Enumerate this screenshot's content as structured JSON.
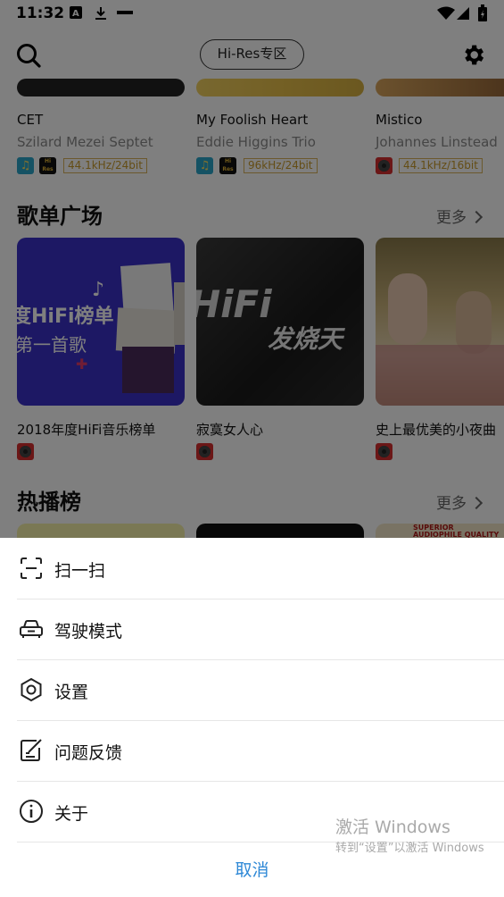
{
  "status_bar": {
    "time": "11:32"
  },
  "top_bar": {
    "hires_button": "Hi-Res专区"
  },
  "albums": [
    {
      "title": "CET",
      "artist": "Szilard Mezei Septet",
      "quality": "44.1kHz/24bit"
    },
    {
      "title": "My Foolish Heart",
      "artist": "Eddie Higgins Trio",
      "quality": "96kHz/24bit"
    },
    {
      "title": "Mistico",
      "artist": "Johannes Linstead",
      "quality": "44.1kHz/16bit"
    }
  ],
  "playlist_section": {
    "title": "歌单广场",
    "more": "更多",
    "items": [
      {
        "title": "2018年度HiFi音乐榜单",
        "cover_text_1": "度HiFi榜单",
        "cover_text_2": "第一首歌"
      },
      {
        "title": "寂寞女人心",
        "cover_text_1": "HiFi",
        "cover_text_2": "发烧天"
      },
      {
        "title": "史上最优美的小夜曲"
      }
    ]
  },
  "chart_section": {
    "title": "热播榜",
    "more": "更多",
    "thumb_text": "SUPERIOR AUDIOPHILE QUALITY"
  },
  "menu": {
    "items": [
      {
        "label": "扫一扫",
        "icon": "scan-icon"
      },
      {
        "label": "驾驶模式",
        "icon": "car-icon"
      },
      {
        "label": "设置",
        "icon": "hexagon-settings-icon"
      },
      {
        "label": "问题反馈",
        "icon": "feedback-icon"
      },
      {
        "label": "关于",
        "icon": "info-icon"
      }
    ],
    "cancel": "取消"
  },
  "watermark": {
    "line1": "激活 Windows",
    "line2": "转到“设置”以激活 Windows"
  },
  "colors": {
    "accent": "#2e88d6",
    "badge_gold": "#c89a2a",
    "overlay": "rgba(0,0,0,0.5)"
  }
}
